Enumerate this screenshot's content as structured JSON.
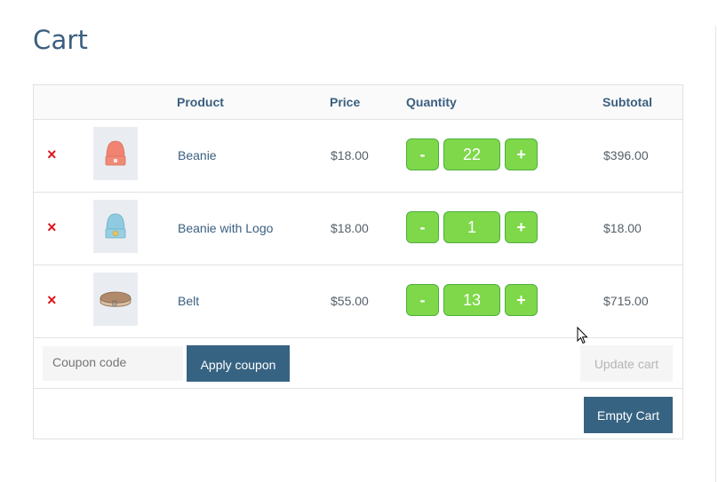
{
  "page": {
    "title": "Cart"
  },
  "table": {
    "headers": {
      "remove": "",
      "thumbnail": "",
      "product": "Product",
      "price": "Price",
      "quantity": "Quantity",
      "subtotal": "Subtotal"
    },
    "items": [
      {
        "remove_icon": "×",
        "image": "red-beanie-icon",
        "name": "Beanie",
        "price": "$18.00",
        "quantity": "22",
        "subtotal": "$396.00"
      },
      {
        "remove_icon": "×",
        "image": "blue-beanie-with-logo-icon",
        "name": "Beanie with Logo",
        "price": "$18.00",
        "quantity": "1",
        "subtotal": "$18.00"
      },
      {
        "remove_icon": "×",
        "image": "belt-icon",
        "name": "Belt",
        "price": "$55.00",
        "quantity": "13",
        "subtotal": "$715.00"
      }
    ],
    "qty_minus_label": "-",
    "qty_plus_label": "+"
  },
  "coupon": {
    "placeholder": "Coupon code",
    "value": "",
    "apply_label": "Apply coupon"
  },
  "actions": {
    "update_label": "Update cart",
    "update_disabled": true,
    "empty_label": "Empty Cart"
  },
  "colors": {
    "accent": "#376382",
    "heading": "#3a5f80",
    "qty_button": "#7ed84a",
    "qty_border": "#4fae3c",
    "remove": "#e2161b"
  }
}
